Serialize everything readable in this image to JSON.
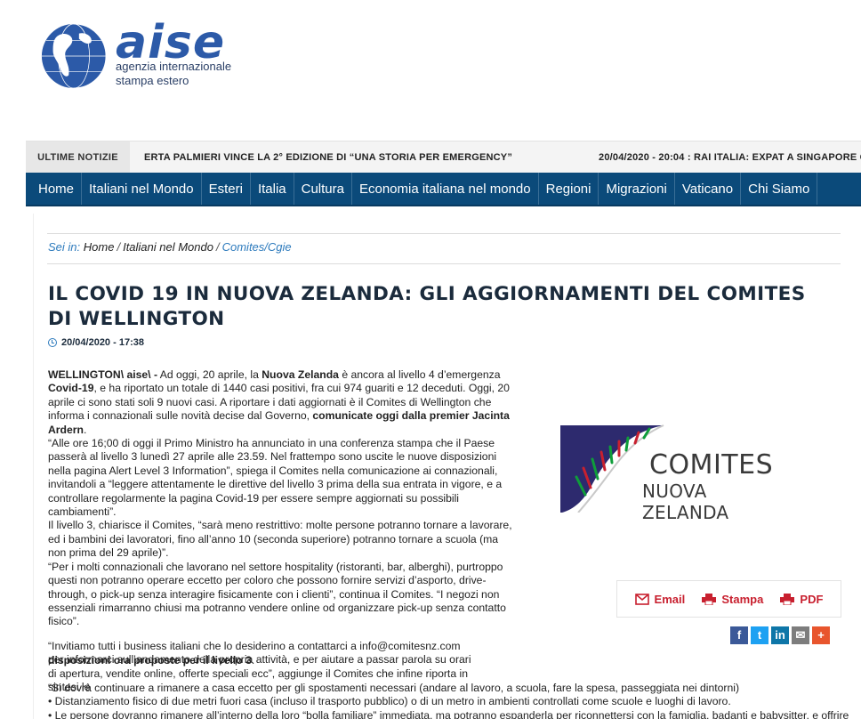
{
  "header": {
    "brand": "aise",
    "tagline1": "agenzia internazionale",
    "tagline2": "stampa estero"
  },
  "ticker": {
    "label": "ULTIME NOTIZIE",
    "item1": "ERTA PALMIERI VINCE LA 2° EDIZIONE DI “UNA STORIA PER EMERGENCY”",
    "item2": "20/04/2020 - 20:04 : RAI ITALIA: EXPAT A SINGAPORE CO"
  },
  "nav": {
    "items": [
      "Home",
      "Italiani nel Mondo",
      "Esteri",
      "Italia",
      "Cultura",
      "Economia italiana nel mondo",
      "Regioni",
      "Migrazioni",
      "Vaticano",
      "Chi Siamo"
    ]
  },
  "breadcrumb": {
    "intro": "Sei in:",
    "home": "Home",
    "section": "Italiani nel Mondo",
    "current": "Comites/Cgie"
  },
  "article": {
    "title": "IL COVID 19 IN NUOVA ZELANDA: GLI AGGIORNAMENTI DEL COMITES DI WELLINGTON",
    "date": "20/04/2020 - 17:38",
    "p1_a": "WELLINGTON\\ aise\\ -",
    "p1_b": " Ad oggi, 20 aprile, la ",
    "p1_c": "Nuova Zelanda",
    "p1_d": " è ancora al livello 4 d’emergenza ",
    "p1_e": "Covid-19",
    "p1_f": ", e ha riportato un totale di 1440 casi positivi, fra cui 974 guariti e 12 deceduti. Oggi, 20 aprile ci sono stati soli 9 nuovi casi. A riportare i dati aggiornati è il Comites di Wellington che informa i connazionali sulle novità decise dal Governo, ",
    "p1_g": "comunicate oggi dalla premier Jacinta Ardern",
    "p1_h": ".",
    "p2": "“Alle ore 16;00 di oggi il Primo Ministro ha annunciato in una conferenza stampa che il Paese passerà al livello 3 lunedì 27 aprile alle 23.59. Nel frattempo sono uscite le nuove disposizioni nella pagina Alert Level 3 Information”, spiega il Comites nella comunicazione ai connazionali, invitandoli a “leggere attentamente le direttive del livello 3 prima della sua entrata in vigore, e a controllare regolarmente la pagina Covid-19 per essere sempre aggiornati su possibili cambiamenti”.",
    "p3": "Il livello 3, chiarisce il Comites, “sarà meno restrittivo: molte persone potranno tornare a lavorare, ed i bambini dei lavoratori, fino all’anno 10 (seconda superiore) potranno tornare a scuola (ma non prima del 29 aprile)”.",
    "p4": "“Per i molti connazionali che lavorano nel settore hospitality (ristoranti, bar, alberghi), purtroppo questi non potranno operare eccetto per coloro che possono fornire servizi d’asporto, drive-through, o pick-up senza interagire fisicamente con i clienti”, continua il Comites. “I negozi non essenziali rimarranno chiusi ma potranno vendere online od organizzare pick-up senza contatto fisico”.",
    "p5_a": "“Invitiamo tutti i business italiani che lo desiderino a contattarci a info@comitesnz.com per informarci sull’andamento della propria attività, e per aiutare a passar parola su orari di apertura, vendite online, offerte speciali ecc”, aggiunge il Comites che infine riporta in sintesi le ",
    "p5_b": "disposizioni ora proposte per il livello 3",
    "p5_c": ".",
    "p6": "“Si dovrà continuare a rimanere a casa eccetto per gli spostamenti necessari (andare al lavoro, a scuola, fare la spesa, passeggiata nei dintorni)",
    "p7": "• Distanziamento fisico di due metri fuori casa (incluso il trasporto pubblico) o di un metro in ambienti controllati come scuole e luoghi di lavoro.",
    "p8": "• Le persone dovranno rimanere all’interno della loro “bolla familiare” immediata, ma potranno espanderla per riconnettersi con la famiglia, badanti e babysitter, e offrire"
  },
  "image": {
    "line1": "COMITES",
    "line2": "NUOVA ZELANDA"
  },
  "actions": {
    "email": "Email",
    "print": "Stampa",
    "pdf": "PDF"
  },
  "share": {
    "facebook": "f",
    "twitter": "t",
    "linkedin": "in",
    "email": "✉",
    "more": "+"
  }
}
